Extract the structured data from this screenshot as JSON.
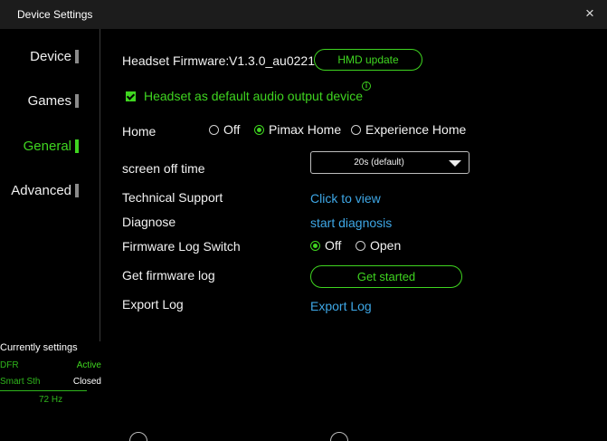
{
  "window": {
    "title": "Device Settings",
    "close_icon": "×"
  },
  "sidebar": {
    "items": [
      {
        "label": "Device",
        "active": false
      },
      {
        "label": "Games",
        "active": false
      },
      {
        "label": "General",
        "active": true
      },
      {
        "label": "Advanced",
        "active": false
      }
    ]
  },
  "current_settings": {
    "title": "Currently settings",
    "rows": [
      {
        "key": "DFR",
        "value": "Active"
      },
      {
        "key": "Smart Sth",
        "value": "Closed"
      }
    ],
    "refresh": "72 Hz"
  },
  "general": {
    "firmware": {
      "label": "Headset Firmware:",
      "version": "V1.3.0_au0221",
      "update_button": "HMD update"
    },
    "audio_default": {
      "label": "Headset as default audio output device",
      "checked": true
    },
    "home": {
      "label": "Home",
      "options": [
        "Off",
        "Pimax Home",
        "Experience Home"
      ],
      "selected": "Pimax Home"
    },
    "screen_off": {
      "label": "screen off time",
      "value": "20s (default)"
    },
    "technical_support": {
      "label": "Technical Support",
      "link": "Click to view"
    },
    "diagnose": {
      "label": "Diagnose",
      "link": "start diagnosis"
    },
    "firmware_log_switch": {
      "label": "Firmware Log Switch",
      "options": [
        "Off",
        "Open"
      ],
      "selected": "Off"
    },
    "get_firmware_log": {
      "label": "Get firmware log",
      "button": "Get started"
    },
    "export_log": {
      "label": "Export Log",
      "link": "Export Log"
    }
  },
  "colors": {
    "accent": "#3fd520",
    "link": "#3ea7e6",
    "background": "#000000",
    "titlebar": "#1c1c1c"
  }
}
